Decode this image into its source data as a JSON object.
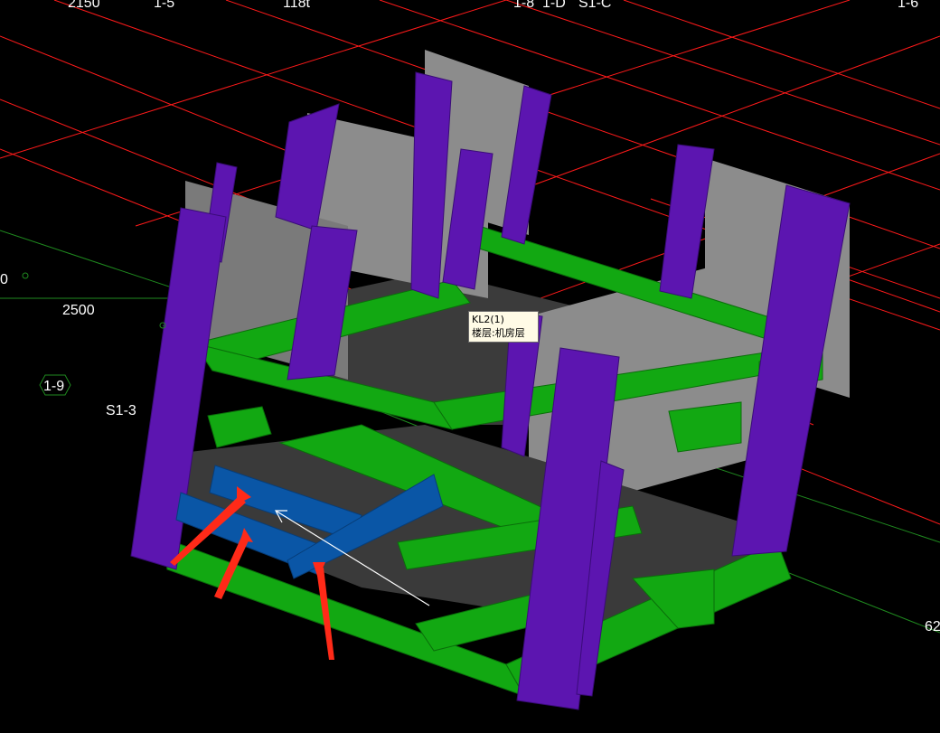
{
  "app": {
    "view": "3D model view"
  },
  "axis_labels": [
    {
      "text": "2150"
    },
    {
      "text": "1-5"
    },
    {
      "text": "118t"
    },
    {
      "text": "1-8"
    },
    {
      "text": "1-D"
    },
    {
      "text": "S1-C"
    },
    {
      "text": "1-6"
    },
    {
      "text": "2500"
    },
    {
      "text": "1-9"
    },
    {
      "text": "S1-3"
    },
    {
      "text": "0"
    },
    {
      "text": "62"
    }
  ],
  "tooltip": {
    "line1": "KL2(1)",
    "line2": "楼层:机房层"
  },
  "colors": {
    "background": "#000000",
    "grid_red": "#ff1a1a",
    "grid_green": "#1f8a1f",
    "column": "#5c15b0",
    "beam": "#12a812",
    "wall": "#8c8c8c",
    "slab": "#3b3b3b",
    "selected_beam": "#0a56a6",
    "annotation_arrow": "#ff2a18"
  },
  "icons": [
    "axis-bubble-icon",
    "annotation-arrow-icon",
    "cursor-arrow-icon"
  ]
}
